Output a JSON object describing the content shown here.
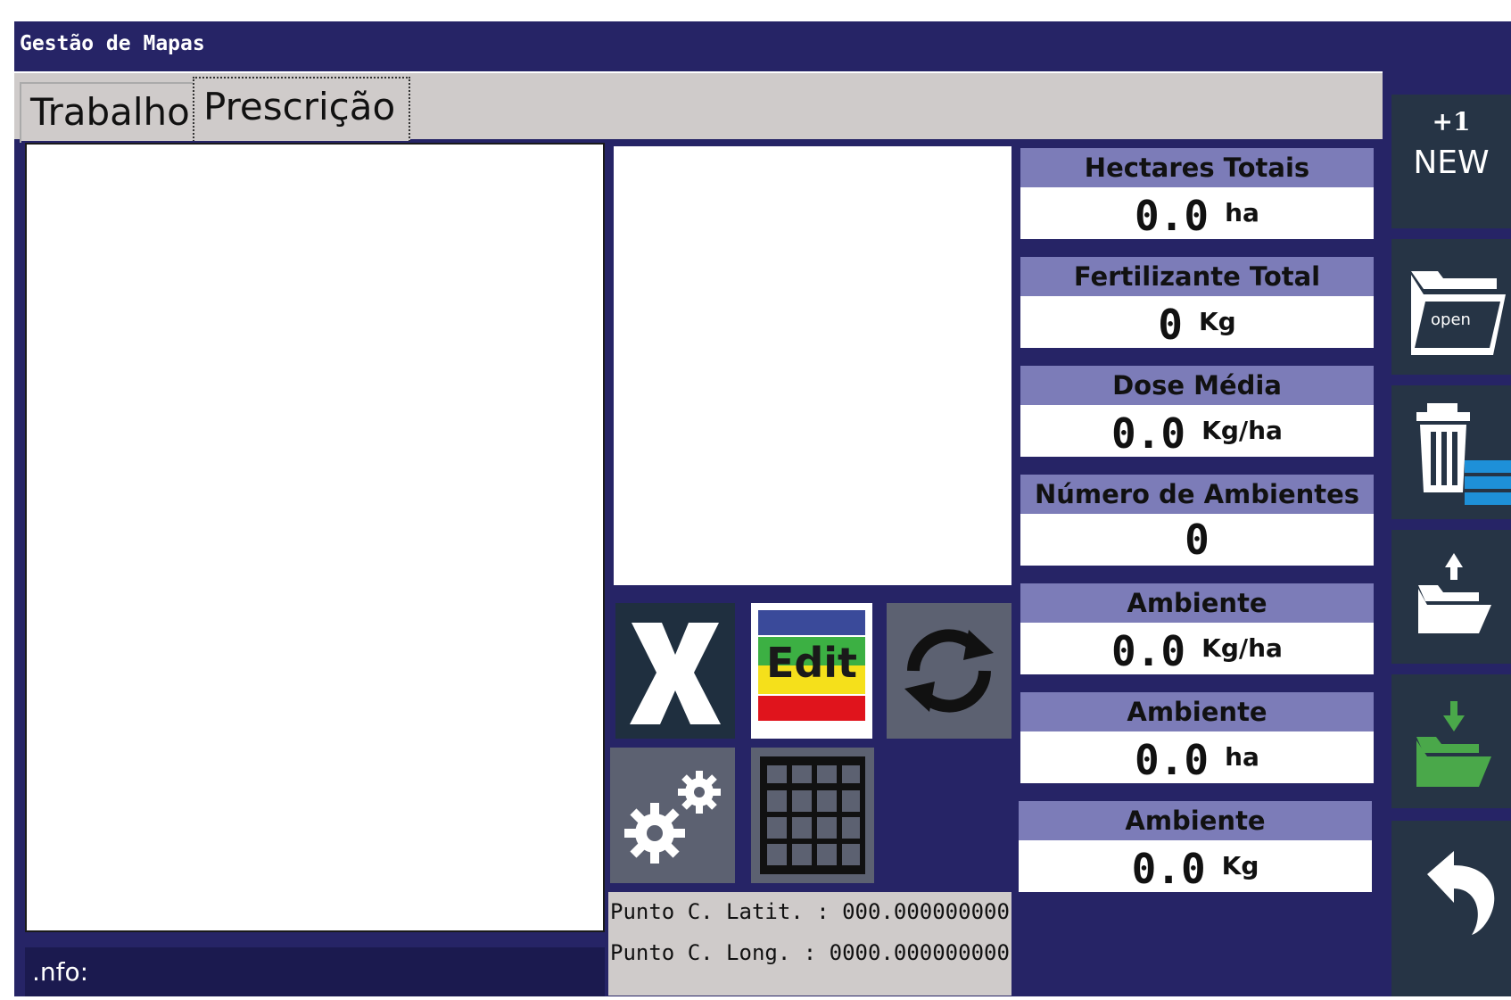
{
  "window": {
    "title": "Gestão de Mapas"
  },
  "tabs": [
    {
      "label": "Trabalho",
      "active": false
    },
    {
      "label": "Prescrição",
      "active": true
    }
  ],
  "info": {
    "label": ".nfo:"
  },
  "toolbar": {
    "edit_label": "Edit"
  },
  "coords": {
    "lat": "Punto C. Latit. :  000.000000000",
    "long": "Punto C. Long. :  0000.000000000"
  },
  "stats": [
    {
      "label": "Hectares Totais",
      "value": "0.0",
      "unit": "ha"
    },
    {
      "label": "Fertilizante Total",
      "value": "0",
      "unit": "Kg"
    },
    {
      "label": "Dose Média",
      "value": "0.0",
      "unit": "Kg/ha"
    },
    {
      "label": "Número de Ambientes",
      "value": "0",
      "unit": ""
    },
    {
      "label": "Ambiente",
      "value": "0.0",
      "unit": "Kg/ha"
    },
    {
      "label": "Ambiente",
      "value": "0.0",
      "unit": "ha"
    },
    {
      "label": "Ambiente",
      "value": "0.0",
      "unit": "Kg"
    }
  ],
  "sidebar": {
    "new_top": "+1",
    "new_label": "NEW",
    "open_label": "open"
  },
  "colors": {
    "background": "#262466",
    "header_bar": "#7c7cb8",
    "tab_bar": "#cfcbca",
    "button_dark": "#263445",
    "accent_blue": "#1e90d8",
    "accent_green": "#4aa84a"
  }
}
